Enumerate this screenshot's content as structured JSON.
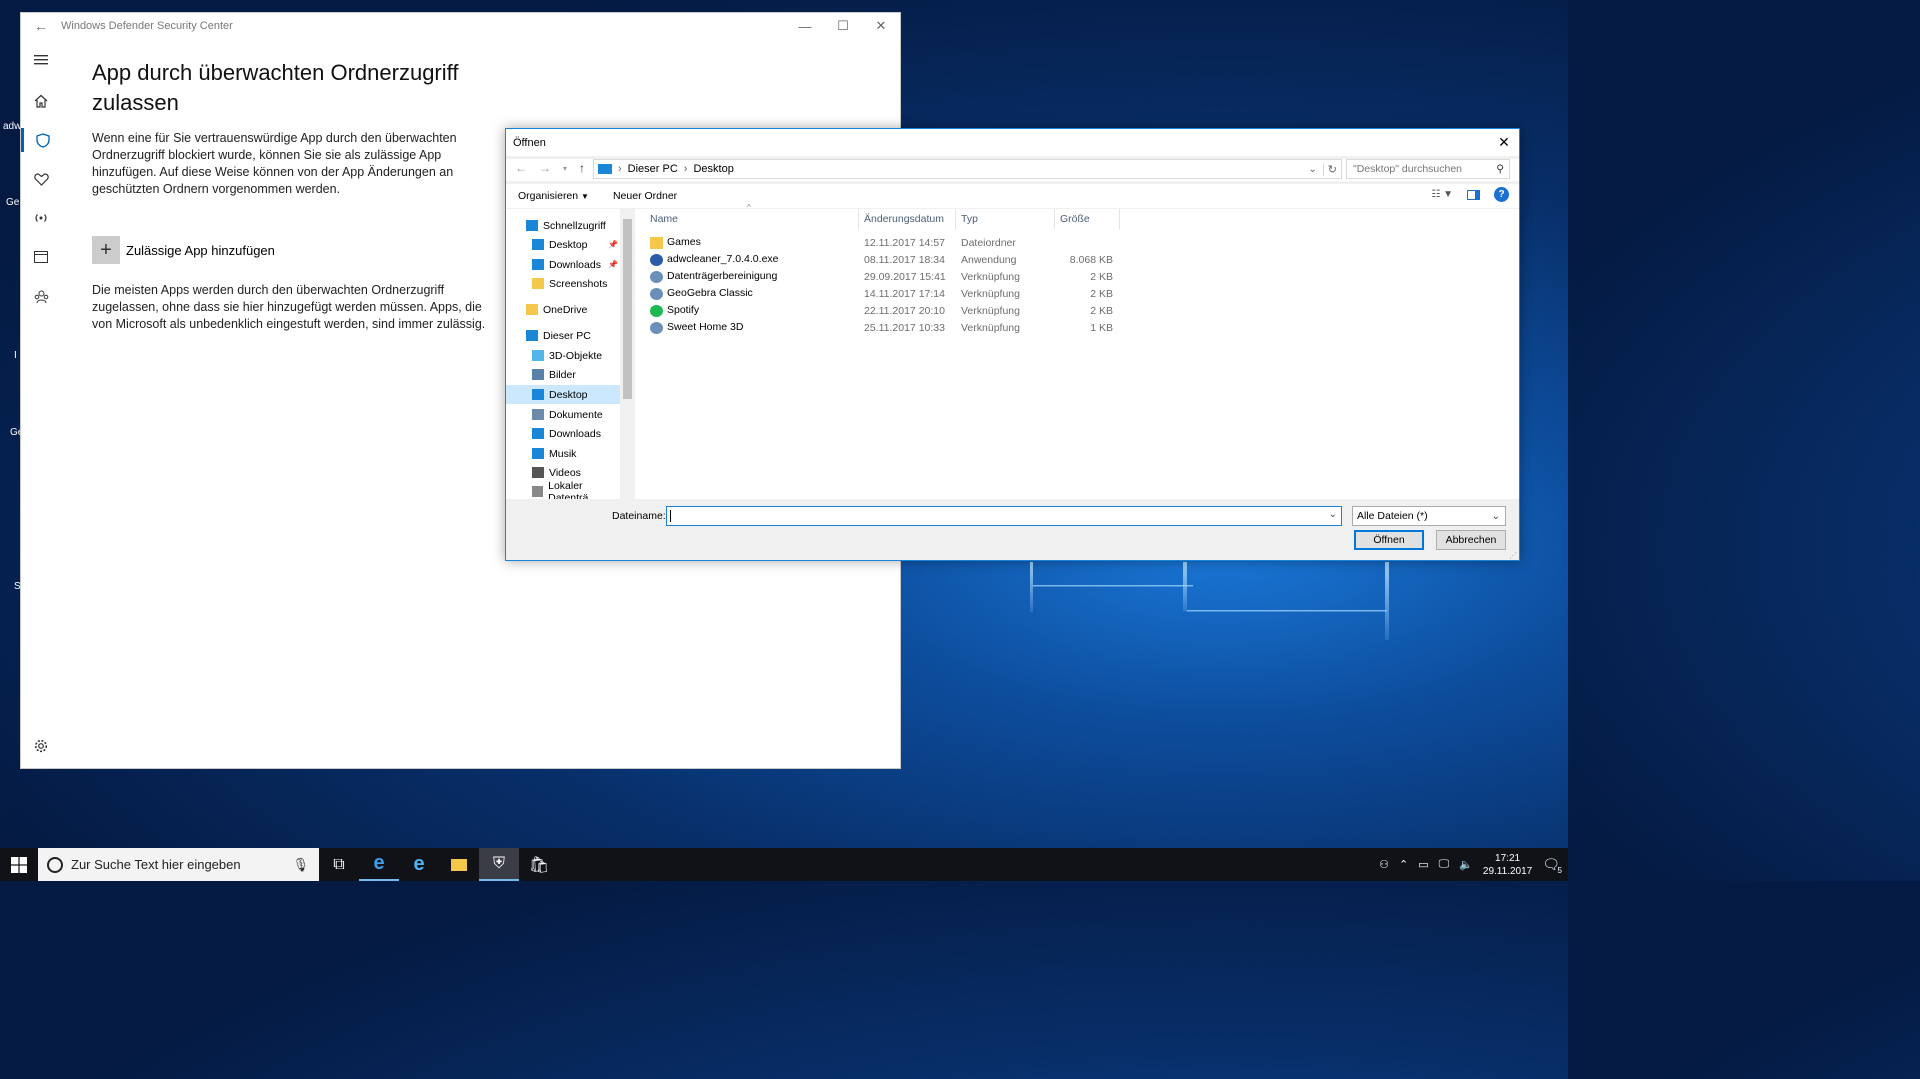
{
  "desktop": {
    "icon_labels": [
      "adw",
      "Ge",
      "I",
      "Ge",
      "S"
    ]
  },
  "defender": {
    "window_title": "Windows Defender Security Center",
    "heading": "App durch überwachten Ordnerzugriff zulassen",
    "description": "Wenn eine für Sie vertrauenswürdige App durch den überwachten Ordnerzugriff blockiert wurde, können Sie sie als zulässige App hinzufügen. Auf diese Weise können von der App Änderungen an geschützten Ordnern vorgenommen werden.",
    "add_app_label": "Zulässige App hinzufügen",
    "info_text": "Die meisten Apps werden durch den überwachten Ordnerzugriff zugelassen, ohne dass sie hier hinzugefügt werden müssen. Apps, die von Microsoft als unbedenklich eingestuft werden, sind immer zulässig.",
    "nav_icons": [
      "hamburger-icon",
      "home-icon",
      "shield-icon",
      "heart-icon",
      "wireless-icon",
      "browser-icon",
      "family-icon",
      "gear-icon"
    ]
  },
  "dialog": {
    "title": "Öffnen",
    "breadcrumb": [
      "Dieser PC",
      "Desktop"
    ],
    "search_placeholder": "\"Desktop\" durchsuchen",
    "toolbar": {
      "organize": "Organisieren",
      "new_folder": "Neuer Ordner"
    },
    "nav_items": [
      {
        "label": "Schnellzugriff",
        "icon": "star-icon",
        "pinned": false
      },
      {
        "label": "Desktop",
        "icon": "desktop-icon",
        "pinned": true
      },
      {
        "label": "Downloads",
        "icon": "download-icon",
        "pinned": true
      },
      {
        "label": "Screenshots",
        "icon": "folder-icon",
        "pinned": false
      },
      {
        "label": "OneDrive",
        "icon": "folder-icon",
        "pinned": false
      },
      {
        "label": "Dieser PC",
        "icon": "pc-icon",
        "pinned": false
      },
      {
        "label": "3D-Objekte",
        "icon": "cube-icon",
        "pinned": false
      },
      {
        "label": "Bilder",
        "icon": "pictures-icon",
        "pinned": false
      },
      {
        "label": "Desktop",
        "icon": "desktop-icon",
        "pinned": false,
        "selected": true
      },
      {
        "label": "Dokumente",
        "icon": "document-icon",
        "pinned": false
      },
      {
        "label": "Downloads",
        "icon": "download-icon",
        "pinned": false
      },
      {
        "label": "Musik",
        "icon": "music-icon",
        "pinned": false
      },
      {
        "label": "Videos",
        "icon": "video-icon",
        "pinned": false
      },
      {
        "label": "Lokaler Datenträ",
        "icon": "drive-icon",
        "pinned": false
      }
    ],
    "columns": [
      "Name",
      "Änderungsdatum",
      "Typ",
      "Größe"
    ],
    "files": [
      {
        "name": "Games",
        "date": "12.11.2017 14:57",
        "type": "Dateiordner",
        "size": "",
        "icon": "folder-icon"
      },
      {
        "name": "adwcleaner_7.0.4.0.exe",
        "date": "08.11.2017 18:34",
        "type": "Anwendung",
        "size": "8.068 KB",
        "icon": "app-icon"
      },
      {
        "name": "Datenträgerbereinigung",
        "date": "29.09.2017 15:41",
        "type": "Verknüpfung",
        "size": "2 KB",
        "icon": "shortcut-icon"
      },
      {
        "name": "GeoGebra Classic",
        "date": "14.11.2017 17:14",
        "type": "Verknüpfung",
        "size": "2 KB",
        "icon": "shortcut-icon"
      },
      {
        "name": "Spotify",
        "date": "22.11.2017 20:10",
        "type": "Verknüpfung",
        "size": "2 KB",
        "icon": "spotify-icon"
      },
      {
        "name": "Sweet Home 3D",
        "date": "25.11.2017 10:33",
        "type": "Verknüpfung",
        "size": "1 KB",
        "icon": "shortcut-icon"
      }
    ],
    "filename_label": "Dateiname:",
    "filename_value": "",
    "filetype_value": "Alle Dateien (*)",
    "open_button": "Öffnen",
    "cancel_button": "Abbrechen"
  },
  "taskbar": {
    "search_placeholder": "Zur Suche Text hier eingeben",
    "time": "17:21",
    "date": "29.11.2017",
    "notification_count": "5"
  },
  "colors": {
    "accent": "#0078d7",
    "selection": "#cce8ff",
    "taskbar": "#101218"
  }
}
